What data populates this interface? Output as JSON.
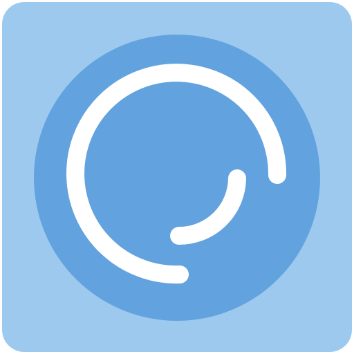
{
  "icon": {
    "name": "spiral-loader-icon",
    "colors": {
      "tile": "#9DC9EE",
      "disc": "#62A2DE",
      "stroke": "#FFFFFF"
    }
  }
}
